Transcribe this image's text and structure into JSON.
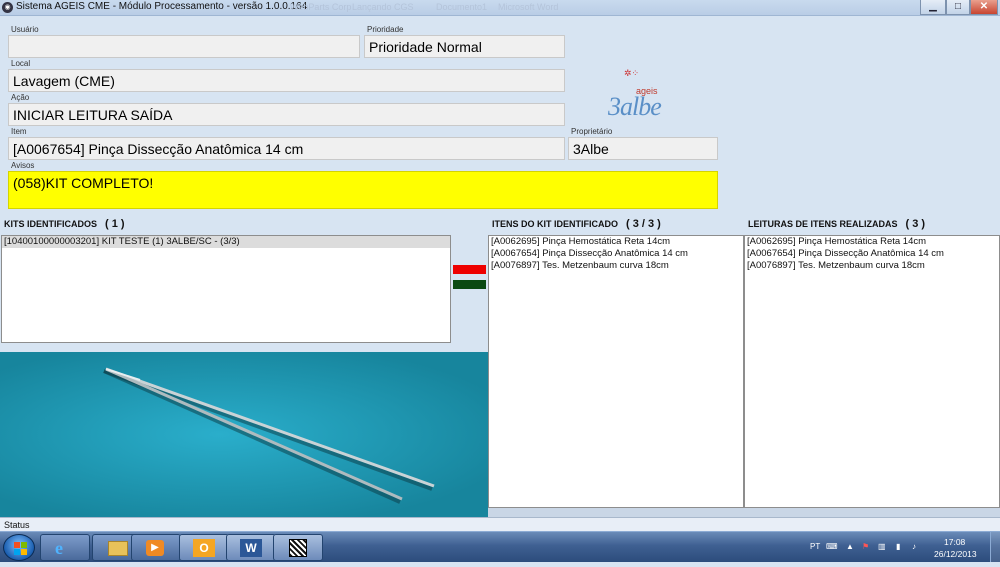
{
  "window": {
    "title": "Sistema AGEIS CME - Módulo Processamento - versão 1.0.0.164",
    "ghost_tabs": [
      "WebParts Corp",
      "Lançando CGS",
      "Documento1",
      "Microsoft Word"
    ],
    "controls": {
      "minimize": "▁",
      "maximize": "□",
      "close": "✕"
    }
  },
  "form": {
    "usuario": {
      "label": "Usuário",
      "value": ""
    },
    "prioridade": {
      "label": "Prioridade",
      "value": "Prioridade Normal"
    },
    "local": {
      "label": "Local",
      "value": "Lavagem (CME)"
    },
    "acao": {
      "label": "Ação",
      "value": "INICIAR LEITURA SAÍDA"
    },
    "item": {
      "label": "Item",
      "value": "[A0067654] Pinça Dissecção Anatômica 14 cm"
    },
    "proprietario": {
      "label": "Proprietário",
      "value": "3Albe"
    },
    "avisos": {
      "label": "Avisos",
      "value": "(058)KIT COMPLETO!"
    }
  },
  "logo": {
    "small": "ageis",
    "big": "3albe"
  },
  "kits": {
    "title": "KITS IDENTIFICADOS",
    "count": "( 1 )",
    "items": [
      "[10400100000003201] KIT TESTE (1) 3ALBE/SC - (3/3)"
    ]
  },
  "kit_items": {
    "title": "ITENS DO KIT IDENTIFICADO",
    "count": "( 3 / 3 )",
    "items": [
      "[A0062695] Pinça Hemostática Reta 14cm",
      "[A0067654] Pinça Dissecção Anatômica 14 cm",
      "[A0076897] Tes. Metzenbaum curva 18cm"
    ]
  },
  "readings": {
    "title": "LEITURAS DE ITENS  REALIZADAS",
    "count": "( 3 )",
    "items": [
      "[A0062695] Pinça Hemostática Reta 14cm",
      "[A0067654] Pinça Dissecção Anatômica 14 cm",
      "[A0076897] Tes. Metzenbaum curva 18cm"
    ]
  },
  "indicators": {
    "red": "#ee0000",
    "green": "#0a4a12"
  },
  "status": {
    "label": "Status"
  },
  "taskbar": {
    "apps": [
      "start-button",
      "internet-explorer-icon",
      "file-explorer-icon",
      "media-player-icon",
      "outlook-icon",
      "word-icon",
      "qr-app-icon"
    ],
    "word_letter": "W",
    "outlook_letter": "O",
    "lang": "PT",
    "time": "17:08",
    "date": "26/12/2013"
  },
  "colors": {
    "background": "#d7e4f2",
    "yellow": "#ffff00",
    "photo_bg": "#1f9bb5"
  }
}
